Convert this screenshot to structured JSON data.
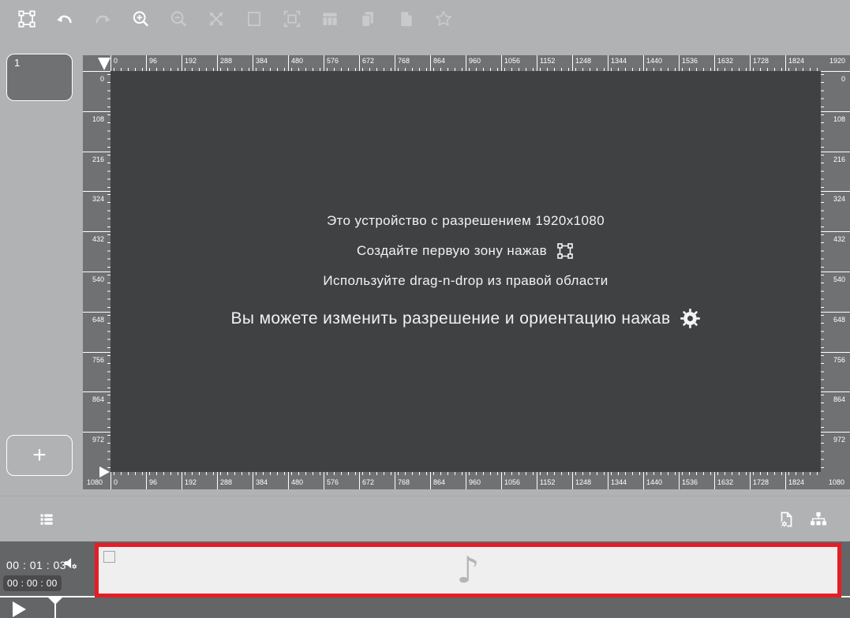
{
  "colors": {
    "background": "#b1b2b4",
    "canvas": "#3f4143",
    "ruler": "#6f7173",
    "timeline": "#636567",
    "accent_red": "#e81c25",
    "icon_enabled": "#ffffff",
    "icon_disabled": "#c9cacc"
  },
  "toolbar": {
    "items": [
      {
        "name": "zone-tool-icon",
        "icon": "zone",
        "enabled": true
      },
      {
        "name": "undo-icon",
        "icon": "undo",
        "enabled": true
      },
      {
        "name": "redo-icon",
        "icon": "redo",
        "enabled": false
      },
      {
        "name": "zoom-in-icon",
        "icon": "zoomin",
        "enabled": true
      },
      {
        "name": "zoom-out-icon",
        "icon": "zoomout",
        "enabled": false
      },
      {
        "name": "expand-arrows-icon",
        "icon": "expand",
        "enabled": false
      },
      {
        "name": "rectangle-zone-icon",
        "icon": "rect",
        "enabled": false
      },
      {
        "name": "fit-to-screen-icon",
        "icon": "fit",
        "enabled": false
      },
      {
        "name": "columns-layout-icon",
        "icon": "columns",
        "enabled": false
      },
      {
        "name": "copy-icon",
        "icon": "copy",
        "enabled": false
      },
      {
        "name": "paste-icon",
        "icon": "paste",
        "enabled": false
      },
      {
        "name": "favorite-star-icon",
        "icon": "star",
        "enabled": false
      }
    ]
  },
  "slides": {
    "items": [
      {
        "label": "1"
      }
    ],
    "add_label": "+"
  },
  "rulers": {
    "h_labels": [
      "0",
      "96",
      "192",
      "288",
      "384",
      "480",
      "576",
      "672",
      "768",
      "864",
      "960",
      "1056",
      "1152",
      "1248",
      "1344",
      "1440",
      "1536",
      "1632",
      "1728",
      "1824"
    ],
    "h_end": "1920",
    "v_labels": [
      "0",
      "108",
      "216",
      "324",
      "432",
      "540",
      "648",
      "756",
      "864",
      "972"
    ],
    "v_end": "1080"
  },
  "canvas": {
    "resolution": "1920x1080",
    "messages": [
      {
        "text": "Это устройство с разрешением 1920x1080"
      },
      {
        "text": "Создайте первую зону нажав",
        "icon": "zone",
        "icon_name": "zone-tool-icon"
      },
      {
        "text": "Используйте drag-n-drop из правой области"
      },
      {
        "text": "Вы можете изменить разрешение и ориентацию нажав",
        "icon": "gear",
        "icon_name": "gear-icon",
        "large": true
      }
    ]
  },
  "bottom_bar": {
    "left_icons": [
      {
        "name": "playlist-icon",
        "icon": "list"
      }
    ],
    "right_icons": [
      {
        "name": "file-settings-icon",
        "icon": "filegear"
      },
      {
        "name": "hierarchy-icon",
        "icon": "sitemap"
      }
    ]
  },
  "timeline": {
    "duration": "00 : 01 : 03",
    "current_time": "00 : 00 : 00",
    "note_glyph": "♪",
    "audio_icon": "speakergear"
  }
}
